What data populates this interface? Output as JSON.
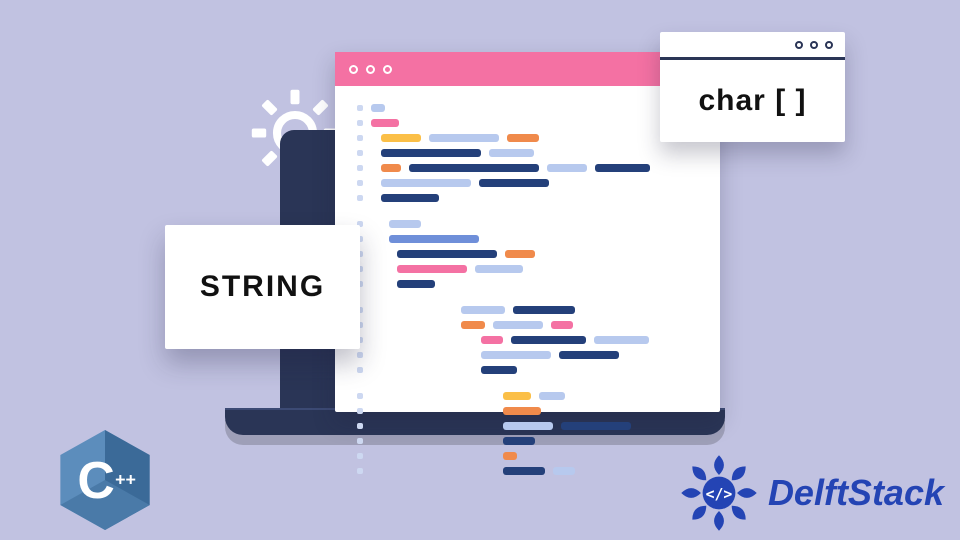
{
  "cards": {
    "string_label": "STRING",
    "char_label": "char [ ]"
  },
  "logos": {
    "cpp_label": "C",
    "cpp_plus": "++",
    "brand_name": "DelftStack"
  },
  "colors": {
    "background": "#c1c2e1",
    "laptop": "#2a3556",
    "titlebar": "#f471a3",
    "navy": "#24407a",
    "orange": "#f08a4b",
    "yellow": "#fbbf47",
    "light_blue": "#b7c9ee",
    "mid_blue": "#6f8fd9",
    "brand_blue": "#2444b4",
    "cpp_blue": "#5c8dbc"
  },
  "icons": {
    "gear": "gear-icon",
    "code_window": "code-window",
    "laptop": "laptop"
  }
}
